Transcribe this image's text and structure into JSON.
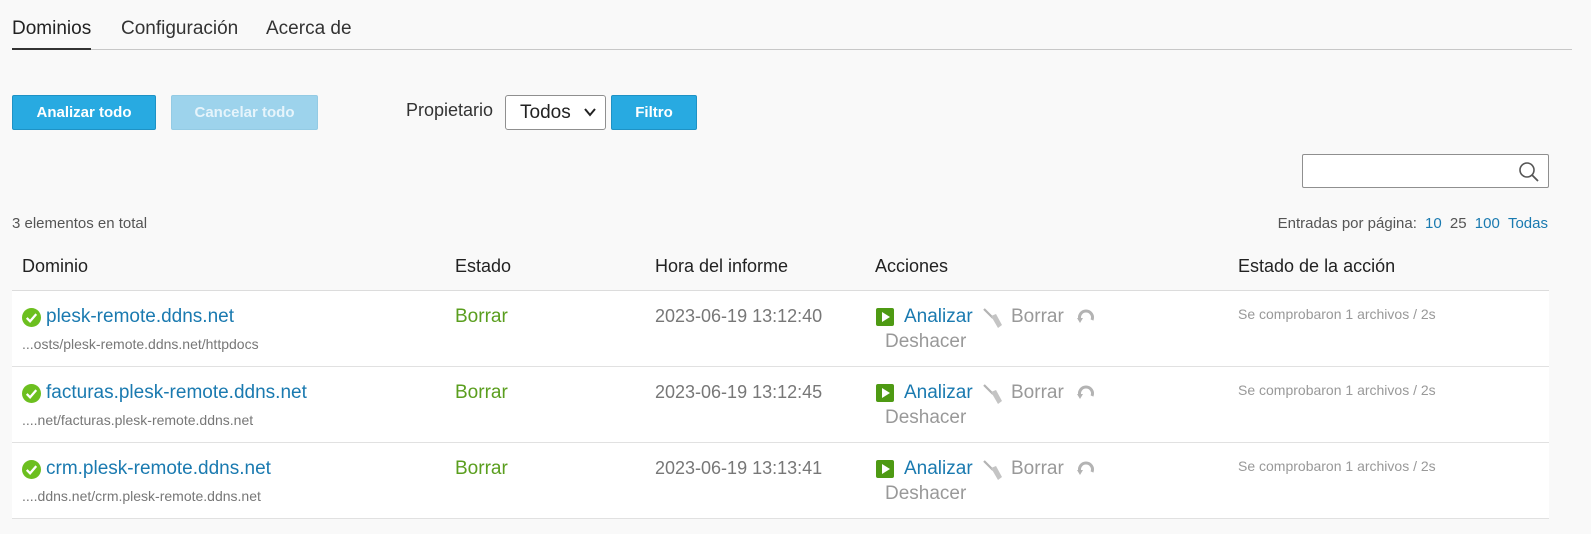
{
  "tabs": [
    {
      "label": "Dominios",
      "active": true
    },
    {
      "label": "Configuración",
      "active": false
    },
    {
      "label": "Acerca de",
      "active": false
    }
  ],
  "toolbar": {
    "analyze_all": "Analizar todo",
    "cancel_all": "Cancelar todo",
    "owner_label": "Propietario",
    "owner_value": "Todos",
    "filter": "Filtro"
  },
  "search": {
    "placeholder": "",
    "value": ""
  },
  "summary": {
    "total": "3 elementos en total",
    "per_page_label": "Entradas por página:",
    "per_page_options": [
      "10",
      "25",
      "100",
      "Todas"
    ],
    "per_page_current": "25"
  },
  "table": {
    "headers": [
      "Dominio",
      "Estado",
      "Hora del informe",
      "Acciones",
      "Estado de la acción"
    ],
    "action_labels": {
      "analyze": "Analizar",
      "delete": "Borrar",
      "undo": "Deshacer"
    },
    "rows": [
      {
        "domain": "plesk-remote.ddns.net",
        "path": "...osts/plesk-remote.ddns.net/httpdocs",
        "status": "Borrar",
        "time": "2023-06-19 13:12:40",
        "action_status": "Se comprobaron 1 archivos / 2s"
      },
      {
        "domain": "facturas.plesk-remote.ddns.net",
        "path": "....net/facturas.plesk-remote.ddns.net",
        "status": "Borrar",
        "time": "2023-06-19 13:12:45",
        "action_status": "Se comprobaron 1 archivos / 2s"
      },
      {
        "domain": "crm.plesk-remote.ddns.net",
        "path": "....ddns.net/crm.plesk-remote.ddns.net",
        "status": "Borrar",
        "time": "2023-06-19 13:13:41",
        "action_status": "Se comprobaron 1 archivos / 2s"
      }
    ]
  },
  "icons": {
    "ok": "check-circle-icon",
    "analyze": "play-icon",
    "delete": "broom-icon",
    "undo": "undo-icon",
    "search": "search-icon",
    "select": "chevron-down-icon"
  },
  "colors": {
    "accent": "#28aae1",
    "link": "#1a7ab0",
    "ok": "#6cbf1f",
    "status_text": "#5a9e1e"
  }
}
